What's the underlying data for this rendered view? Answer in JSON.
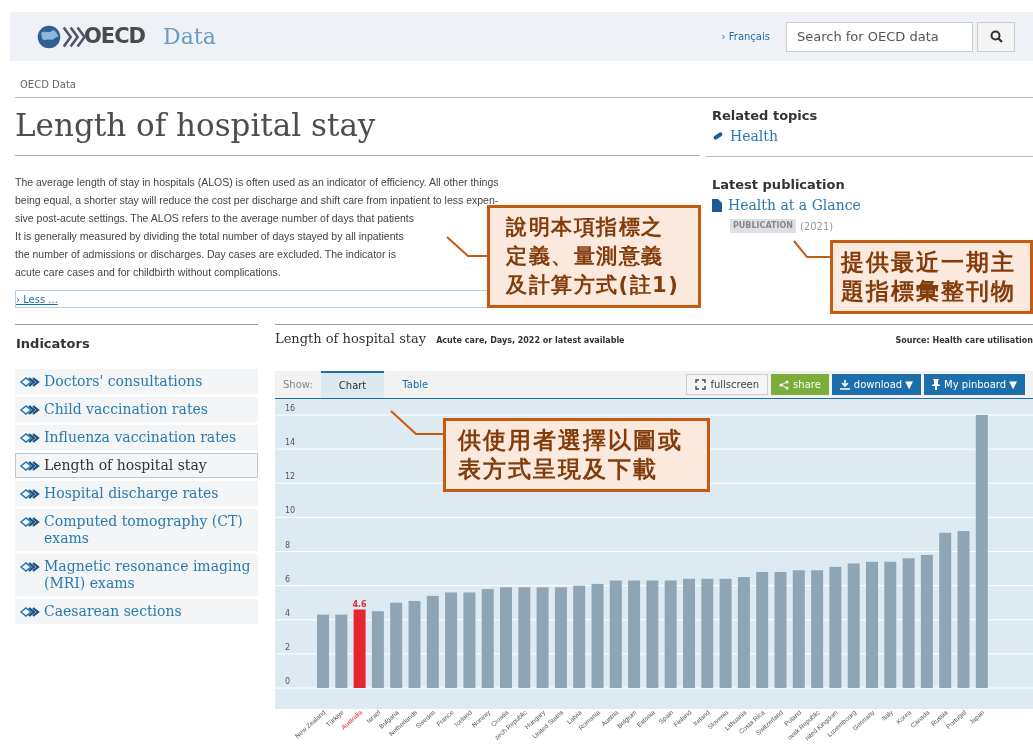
{
  "header": {
    "logo": "OECD",
    "section": "Data",
    "language_link": "› Français",
    "search": {
      "placeholder": "Search for OECD data"
    }
  },
  "breadcrumb": "OECD Data",
  "page_title": "Length of hospital stay",
  "description_lines": [
    "The average length of stay in hospitals (ALOS) is often used as an indicator of efficiency. All other things",
    "being equal, a shorter stay will reduce the cost per discharge and shift care from inpatient to less expen-",
    "sive post-acute settings. The ALOS refers to the average number of days that patients",
    "It is generally measured by dividing the total number of days stayed by all inpatients",
    "the number of admissions or discharges. Day cases are excluded. The indicator is",
    "acute care cases and for childbirth without complications."
  ],
  "less_link": "› Less ...",
  "related_topics": {
    "heading": "Related topics",
    "items": [
      "Health"
    ]
  },
  "latest_publication": {
    "heading": "Latest publication",
    "title": "Health at a Glance",
    "badge": "PUBLICATION",
    "year": "(2021)"
  },
  "indicators": {
    "heading": "Indicators",
    "items": [
      {
        "label": "Doctors' consultations",
        "selected": false
      },
      {
        "label": "Child vaccination rates",
        "selected": false
      },
      {
        "label": "Influenza vaccination rates",
        "selected": false
      },
      {
        "label": "Length of hospital stay",
        "selected": true
      },
      {
        "label": "Hospital discharge rates",
        "selected": false
      },
      {
        "label": "Computed tomography (CT) exams",
        "selected": false
      },
      {
        "label": "Magnetic resonance imaging (MRI) exams",
        "selected": false
      },
      {
        "label": "Caesarean sections",
        "selected": false
      }
    ]
  },
  "chart_panel": {
    "title": "Length of hospital stay",
    "subtitle": "Acute care, Days, 2022 or latest available",
    "source": "Source: Health care utilisation",
    "show_label": "Show:",
    "tabs": [
      {
        "label": "Chart",
        "selected": true
      },
      {
        "label": "Table",
        "selected": false
      }
    ],
    "buttons": [
      {
        "label": "fullscreen",
        "kind": "fullscreen"
      },
      {
        "label": "share",
        "kind": "share"
      },
      {
        "label": "download ▼",
        "kind": "download"
      },
      {
        "label": "My pinboard ▼",
        "kind": "pinboard"
      }
    ],
    "chart_data": {
      "type": "bar",
      "grid": true,
      "categories": [
        "New Zealand",
        "Türkiye",
        "Australia",
        "Israel",
        "Bulgaria",
        "Netherlands",
        "Sweden",
        "France",
        "Iceland",
        "Norway",
        "Croatia",
        "zech Republic",
        "Hungary",
        "United States",
        "Latvia",
        "Romania",
        "Austria",
        "Belgium",
        "Estonia",
        "Spain",
        "Finland",
        "Ireland",
        "Slovenia",
        "Lithuania",
        "Costa Rica",
        "Switzerland",
        "Poland",
        "ovak Republic",
        "nited Kingdom",
        "Luxembourg",
        "Germany",
        "Italy",
        "Korea",
        "Canada",
        "Russia",
        "Portugal",
        "Japan"
      ],
      "stacked": true,
      "series": [
        {
          "color": "#8fa5b3",
          "values": [
            4.3,
            4.3,
            null,
            4.5,
            5.0,
            5.1,
            5.4,
            5.6,
            5.6,
            5.8,
            5.9,
            5.9,
            5.9,
            5.9,
            6.0,
            6.1,
            6.3,
            6.3,
            6.3,
            6.3,
            6.4,
            6.4,
            6.4,
            6.5,
            6.8,
            6.8,
            6.9,
            6.9,
            7.1,
            7.3,
            7.4,
            7.4,
            7.6,
            7.8,
            9.1,
            9.2,
            16.0
          ]
        },
        {
          "color": "#e5262f",
          "data_labels": true,
          "values": [
            null,
            null,
            4.6,
            null,
            null,
            null,
            null,
            null,
            null,
            null,
            null,
            null,
            null,
            null,
            null,
            null,
            null,
            null,
            null,
            null,
            null,
            null,
            null,
            null,
            null,
            null,
            null,
            null,
            null,
            null,
            null,
            null,
            null,
            null,
            null,
            null,
            null
          ]
        }
      ],
      "ylim": [
        0,
        16
      ],
      "yticks": [
        0,
        2,
        4,
        6,
        8,
        10,
        12,
        14,
        16
      ]
    }
  },
  "callouts": [
    {
      "text": "說明本項指標之定義、量測意義及計算方式(註1)",
      "kind": "definition"
    },
    {
      "text": "提供最近一期主題指標彙整刊物",
      "kind": "publication"
    },
    {
      "text": "供使用者選擇以圖或表方式呈現及下載",
      "kind": "chart"
    }
  ]
}
